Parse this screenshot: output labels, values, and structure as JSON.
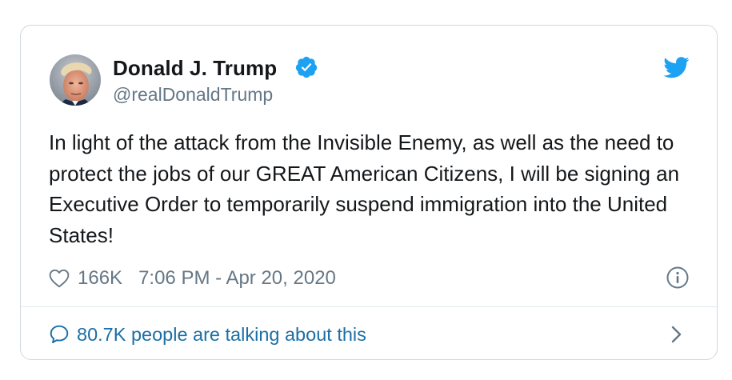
{
  "tweet": {
    "author_name": "Donald J. Trump",
    "author_handle": "@realDonaldTrump",
    "verified": true,
    "text": "In light of the attack from the Invisible Enemy, as well as the need to protect the jobs of our GREAT American Citizens, I will be signing an Executive Order to temporarily suspend immigration into the United States!",
    "likes": "166K",
    "timestamp": "7:06 PM - Apr 20, 2020",
    "talking_text": "80.7K people are talking about this"
  },
  "icons": {
    "avatar": "avatar",
    "verified": "verified-badge-icon",
    "brand": "twitter-bird-icon",
    "like": "heart-icon",
    "info": "info-icon",
    "reply": "speech-bubble-icon",
    "more": "chevron-right-icon"
  },
  "colors": {
    "brand_blue": "#1da1f2",
    "link_blue": "#1b6fa6",
    "text_dark": "#14171a",
    "text_gray": "#657786",
    "border": "#cfd9de"
  }
}
